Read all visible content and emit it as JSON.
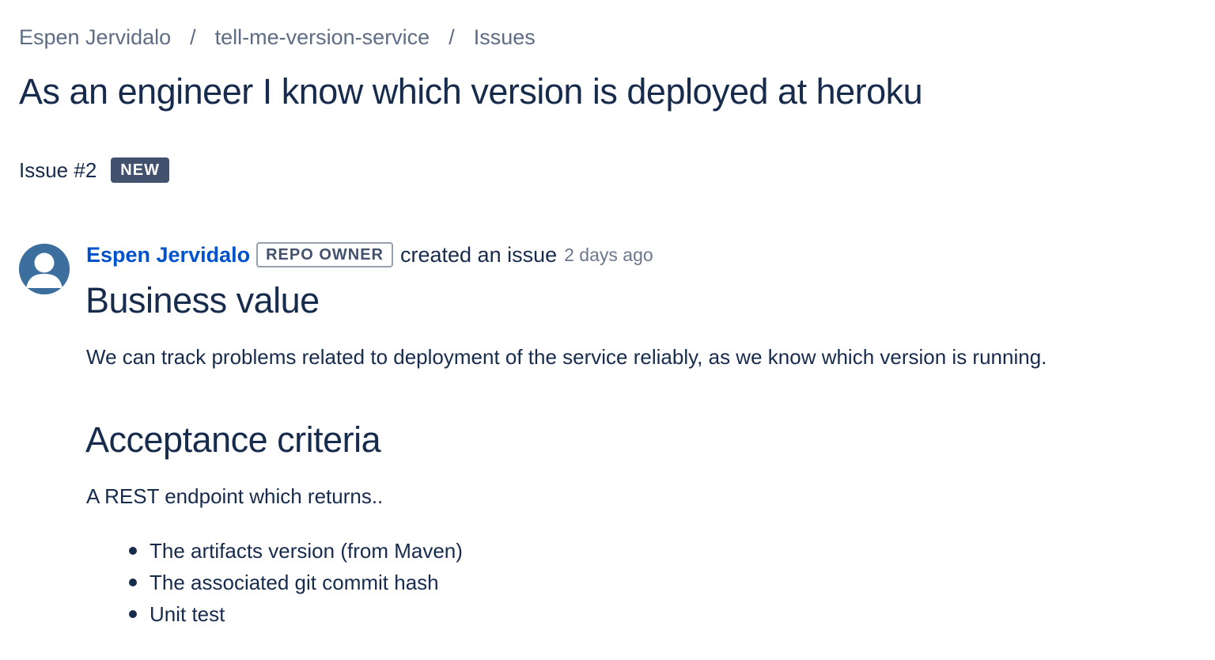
{
  "breadcrumb": {
    "items": [
      "Espen Jervidalo",
      "tell-me-version-service",
      "Issues"
    ],
    "separator": "/"
  },
  "issue": {
    "title": "As an engineer I know which version is deployed at heroku",
    "number_label": "Issue #2",
    "status": "NEW"
  },
  "comment": {
    "author": "Espen Jervidalo",
    "role": "REPO OWNER",
    "action": "created an issue",
    "time": "2 days ago",
    "avatar_icon": "user-avatar-icon"
  },
  "content": {
    "business_heading": "Business value",
    "business_text": "We can track problems related to deployment of the service reliably, as we know which version is running.",
    "acceptance_heading": "Acceptance criteria",
    "acceptance_text": "A REST endpoint which returns..",
    "criteria": [
      "The artifacts version (from Maven)",
      "The associated git commit hash",
      "Unit test"
    ]
  },
  "colors": {
    "text": "#172B4D",
    "muted": "#5E6C84",
    "link": "#0052CC",
    "badge_bg": "#42526E",
    "avatar_bg": "#3C6E9E"
  }
}
